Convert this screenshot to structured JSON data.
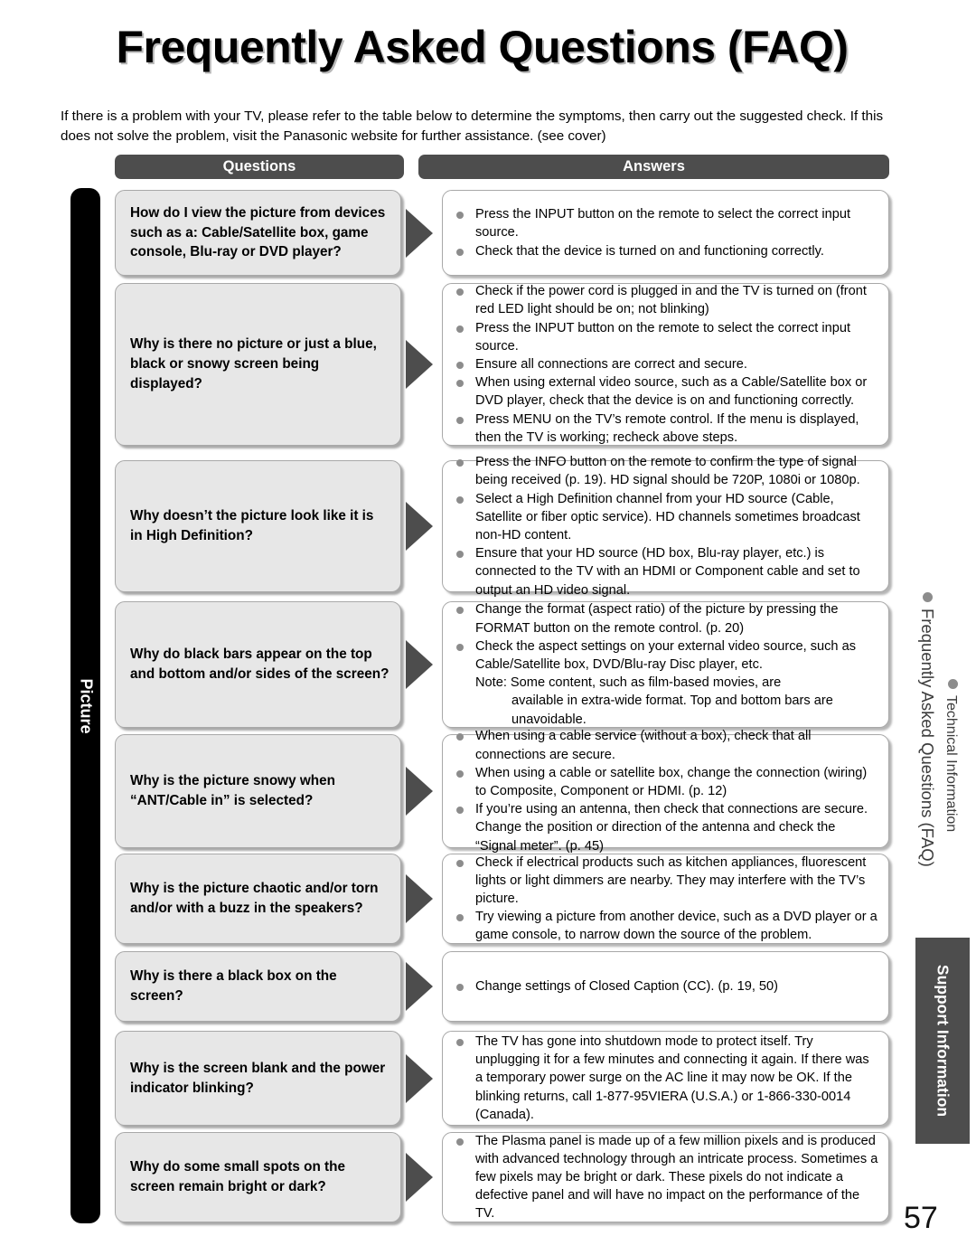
{
  "page": {
    "title": "Frequently Asked Questions (FAQ)",
    "intro": "If there is a problem with your TV, please refer to the table below to determine the symptoms, then carry out the suggested check. If this does not solve the problem, visit the Panasonic website for further assistance. (see cover)",
    "page_number": "57",
    "colors": {
      "header_bar": "#4d4d4d",
      "question_box": "#e7e7e7",
      "answer_box": "#ffffff",
      "bullet": "#8c8c8c",
      "arrow": "#4d4d4d",
      "category_bar": "#000000"
    }
  },
  "table": {
    "headers": {
      "questions": "Questions",
      "answers": "Answers"
    },
    "category_label": "Picture",
    "rows": [
      {
        "question": "How do I view the picture from devices such as a: Cable/Satellite box,  game console, Blu-ray or DVD player?",
        "answers": [
          "Press the INPUT button on the remote to select the correct input source.",
          "Check that the device is turned on and functioning correctly."
        ]
      },
      {
        "question": "Why is there no picture or just a blue, black or snowy screen being displayed?",
        "answers": [
          "Check if the power cord is plugged in and the TV is turned on (front red LED light should be on; not blinking)",
          "Press the INPUT button on the remote to select the correct input source.",
          "Ensure all connections are correct and secure.",
          "When using external video source, such as a Cable/Satellite box or DVD player, check that the device is on and functioning correctly.",
          "Press MENU on the TV’s remote control. If the menu is displayed, then the TV is working; recheck above steps."
        ]
      },
      {
        "question": "Why doesn’t the picture look like it is in High Definition?",
        "answers": [
          "Press the INFO button on the remote to confirm the type of signal being received (p. 19). HD signal should be 720P, 1080i or 1080p.",
          "Select a High Definition channel from your HD source (Cable, Satellite or fiber optic service). HD channels sometimes broadcast non-HD content.",
          "Ensure that your HD source (HD box, Blu-ray player, etc.) is connected to the TV with an HDMI or Component cable and set to output an HD video signal."
        ]
      },
      {
        "question": "Why do black bars appear on the top and bottom and/or sides of the screen?",
        "answers": [
          "Change the format (aspect ratio) of the picture by pressing the FORMAT button on the remote control. (p. 20)",
          "Check the aspect settings on your external video source, such as Cable/Satellite box, DVD/Blu-ray Disc player, etc."
        ],
        "note": "Note: Some content, such as film-based movies, are",
        "note_continued": "available in extra-wide format. Top and bottom bars are unavoidable."
      },
      {
        "question": "Why is the picture snowy when “ANT/Cable in” is selected?",
        "answers": [
          "When using a cable service (without a box), check that all connections are secure.",
          "When using a cable or satellite box, change the connection (wiring) to Composite, Component or HDMI. (p. 12)",
          "If you’re using an antenna, then check that connections are secure. Change the position or direction of the antenna and check the “Signal meter”. (p. 45)"
        ]
      },
      {
        "question": "Why is the picture chaotic and/or torn and/or with a buzz in the speakers?",
        "answers": [
          "Check if electrical products such as kitchen appliances, fluorescent lights or light dimmers are nearby. They may interfere with the TV’s picture.",
          "Try viewing a picture from another device, such as a DVD player or a game console, to narrow down the source of the problem."
        ]
      },
      {
        "question": "Why is there a black box on the screen?",
        "answers": [
          "Change settings of Closed Caption (CC). (p. 19, 50)"
        ]
      },
      {
        "question": "Why is the screen blank and the power indicator blinking?",
        "answers": [
          "The TV has gone into shutdown mode to protect itself. Try unplugging it for a few minutes and connecting it again. If there was a temporary power surge on the AC line it may now be OK. If the blinking returns, call 1-877-95VIERA (U.S.A.) or 1-866-330-0014 (Canada)."
        ]
      },
      {
        "question": "Why do some small spots on the screen remain bright or dark?",
        "answers": [
          "The Plasma panel is made up of a few million pixels and is produced with advanced technology through an intricate process. Sometimes a few pixels may be bright or dark. These pixels do not indicate a defective panel and will have no impact on the performance of the TV."
        ]
      }
    ]
  },
  "sidebar": {
    "items": [
      {
        "label": "Frequently Asked Questions (FAQ)"
      },
      {
        "label": "Technical Information"
      }
    ],
    "tab_label": "Support Information"
  }
}
